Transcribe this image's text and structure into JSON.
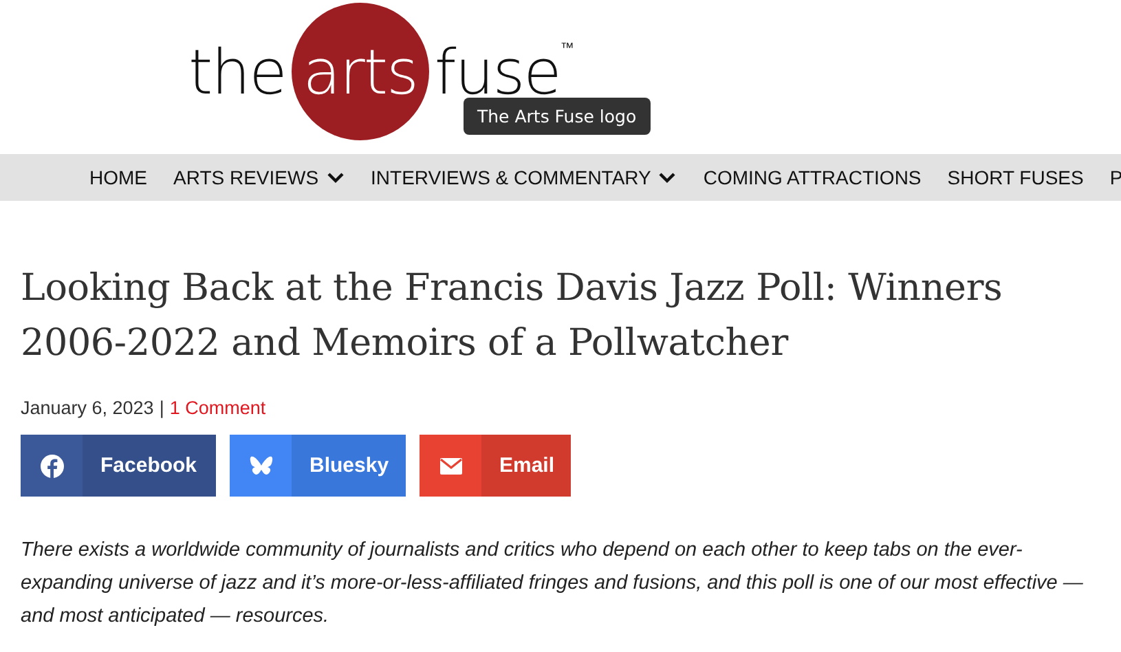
{
  "logo": {
    "before": "the",
    "circle": "arts",
    "after": "fuse",
    "mark": "™",
    "tooltip": "The Arts Fuse logo"
  },
  "nav": [
    {
      "label": "HOME",
      "dropdown": false
    },
    {
      "label": "ARTS REVIEWS",
      "dropdown": true
    },
    {
      "label": "INTERVIEWS & COMMENTARY",
      "dropdown": true
    },
    {
      "label": "COMING ATTRACTIONS",
      "dropdown": false
    },
    {
      "label": "SHORT FUSES",
      "dropdown": false
    },
    {
      "label": "P",
      "dropdown": false
    }
  ],
  "article": {
    "title": "Looking Back at the Francis Davis Jazz Poll: Winners 2006-2022 and Memoirs of a Pollwatcher",
    "date": "January 6, 2023",
    "separator": "|",
    "comments": "1 Comment",
    "share": [
      {
        "kind": "facebook",
        "label": "Facebook"
      },
      {
        "kind": "bluesky",
        "label": "Bluesky"
      },
      {
        "kind": "email",
        "label": "Email"
      }
    ],
    "intro": "There exists a worldwide community of journalists and critics who depend on each other to keep tabs on the ever-expanding universe of jazz and it’s more-or-less-affiliated fringes and fusions, and this poll is one of our most effective — and most anticipated — resources."
  }
}
